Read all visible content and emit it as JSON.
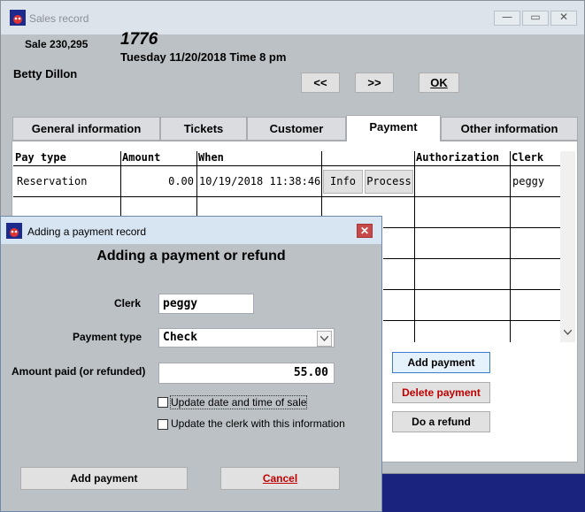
{
  "window": {
    "title": "Sales record"
  },
  "header": {
    "sale_label": "Sale 230,295",
    "sale_number": "1776",
    "date_line": "Tuesday 11/20/2018  Time 8 pm",
    "customer_name": "Betty Dillon",
    "prev_button": "<<",
    "next_button": ">>",
    "ok_button": "OK"
  },
  "tabs": [
    {
      "label": "General information"
    },
    {
      "label": "Tickets"
    },
    {
      "label": "Customer"
    },
    {
      "label": "Payment",
      "active": true
    },
    {
      "label": "Other information"
    }
  ],
  "payment_grid": {
    "columns": [
      "Pay type",
      "Amount",
      "When",
      "Authorization",
      "Clerk"
    ],
    "rows": [
      {
        "pay_type": "Reservation",
        "amount": "0.00",
        "when": "10/19/2018 11:38:46",
        "info_button": "Info",
        "process_button": "Process",
        "authorization": "",
        "clerk": "peggy"
      }
    ]
  },
  "panel_buttons": {
    "add_payment": "Add payment",
    "delete_payment": "Delete payment",
    "do_refund": "Do a refund"
  },
  "dialog": {
    "title": "Adding a payment record",
    "heading": "Adding a payment or refund",
    "clerk_label": "Clerk",
    "clerk_value": "peggy",
    "payment_type_label": "Payment type",
    "payment_type_value": "Check",
    "amount_label": "Amount paid (or refunded)",
    "amount_value": "55.00",
    "update_date_label": "Update date and time of sale",
    "update_clerk_label": "Update the clerk with this information",
    "add_payment_button": "Add payment",
    "cancel_button": "Cancel"
  },
  "colors": {
    "delete_text": "#c00000",
    "cancel_text": "#c00000",
    "desktop": "#1a237e"
  }
}
